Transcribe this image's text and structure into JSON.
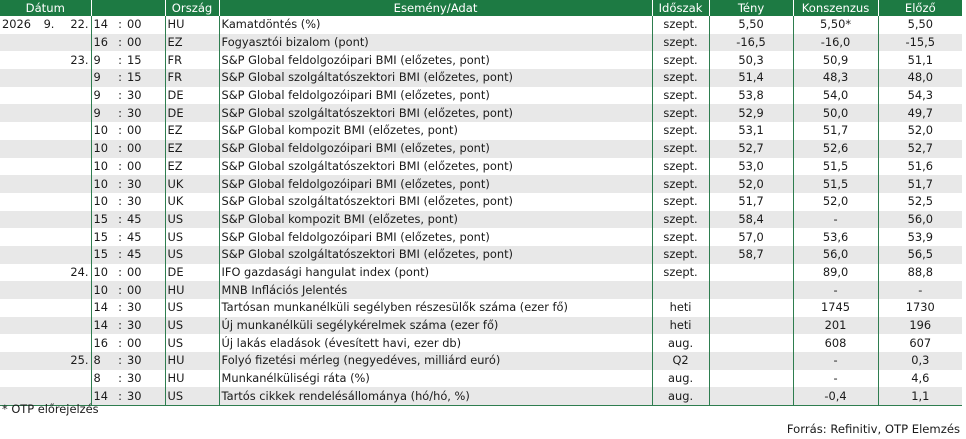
{
  "headers": {
    "date": "Dátum",
    "country": "Ország",
    "event": "Esemény/Adat",
    "period": "Időszak",
    "actual": "Tény",
    "consensus": "Konszenzus",
    "previous": "Előző"
  },
  "rows": [
    {
      "year": "2026",
      "month": "9.",
      "day": "22.",
      "hour": "14",
      "min": "00",
      "country": "HU",
      "event": "Kamatdöntés (%)",
      "period": "szept.",
      "actual": "5,50",
      "consensus": "5,50*",
      "previous": "5,50"
    },
    {
      "year": "",
      "month": "",
      "day": "",
      "hour": "16",
      "min": "00",
      "country": "EZ",
      "event": "Fogyasztói bizalom (pont)",
      "period": "szept.",
      "actual": "-16,5",
      "consensus": "-16,0",
      "previous": "-15,5"
    },
    {
      "year": "",
      "month": "",
      "day": "23.",
      "hour": "9",
      "min": "15",
      "country": "FR",
      "event": "S&P Global feldolgozóipari BMI (előzetes, pont)",
      "period": "szept.",
      "actual": "50,3",
      "consensus": "50,9",
      "previous": "51,1"
    },
    {
      "year": "",
      "month": "",
      "day": "",
      "hour": "9",
      "min": "15",
      "country": "FR",
      "event": "S&P Global szolgáltatószektori BMI (előzetes, pont)",
      "period": "szept.",
      "actual": "51,4",
      "consensus": "48,3",
      "previous": "48,0"
    },
    {
      "year": "",
      "month": "",
      "day": "",
      "hour": "9",
      "min": "30",
      "country": "DE",
      "event": "S&P Global feldolgozóipari BMI (előzetes, pont)",
      "period": "szept.",
      "actual": "53,8",
      "consensus": "54,0",
      "previous": "54,3"
    },
    {
      "year": "",
      "month": "",
      "day": "",
      "hour": "9",
      "min": "30",
      "country": "DE",
      "event": "S&P Global szolgáltatószektori BMI (előzetes, pont)",
      "period": "szept.",
      "actual": "52,9",
      "consensus": "50,0",
      "previous": "49,7"
    },
    {
      "year": "",
      "month": "",
      "day": "",
      "hour": "10",
      "min": "00",
      "country": "EZ",
      "event": "S&P Global kompozit BMI (előzetes, pont)",
      "period": "szept.",
      "actual": "53,1",
      "consensus": "51,7",
      "previous": "52,0"
    },
    {
      "year": "",
      "month": "",
      "day": "",
      "hour": "10",
      "min": "00",
      "country": "EZ",
      "event": "S&P Global feldolgozóipari BMI (előzetes, pont)",
      "period": "szept.",
      "actual": "52,7",
      "consensus": "52,6",
      "previous": "52,7"
    },
    {
      "year": "",
      "month": "",
      "day": "",
      "hour": "10",
      "min": "00",
      "country": "EZ",
      "event": "S&P Global szolgáltatószektori BMI (előzetes, pont)",
      "period": "szept.",
      "actual": "53,0",
      "consensus": "51,5",
      "previous": "51,6"
    },
    {
      "year": "",
      "month": "",
      "day": "",
      "hour": "10",
      "min": "30",
      "country": "UK",
      "event": "S&P Global feldolgozóipari BMI (előzetes, pont)",
      "period": "szept.",
      "actual": "52,0",
      "consensus": "51,5",
      "previous": "51,7"
    },
    {
      "year": "",
      "month": "",
      "day": "",
      "hour": "10",
      "min": "30",
      "country": "UK",
      "event": "S&P Global szolgáltatószektori BMI (előzetes, pont)",
      "period": "szept.",
      "actual": "51,7",
      "consensus": "52,0",
      "previous": "52,5"
    },
    {
      "year": "",
      "month": "",
      "day": "",
      "hour": "15",
      "min": "45",
      "country": "US",
      "event": "S&P Global kompozit BMI (előzetes, pont)",
      "period": "szept.",
      "actual": "58,4",
      "consensus": "-",
      "previous": "56,0"
    },
    {
      "year": "",
      "month": "",
      "day": "",
      "hour": "15",
      "min": "45",
      "country": "US",
      "event": "S&P Global feldolgozóipari BMI (előzetes, pont)",
      "period": "szept.",
      "actual": "57,0",
      "consensus": "53,6",
      "previous": "53,9"
    },
    {
      "year": "",
      "month": "",
      "day": "",
      "hour": "15",
      "min": "45",
      "country": "US",
      "event": "S&P Global szolgáltatószektori BMI (előzetes, pont)",
      "period": "szept.",
      "actual": "58,7",
      "consensus": "56,0",
      "previous": "56,5"
    },
    {
      "year": "",
      "month": "",
      "day": "24.",
      "hour": "10",
      "min": "00",
      "country": "DE",
      "event": "IFO gazdasági hangulat index (pont)",
      "period": "szept.",
      "actual": "",
      "consensus": "89,0",
      "previous": "88,8"
    },
    {
      "year": "",
      "month": "",
      "day": "",
      "hour": "10",
      "min": "00",
      "country": "HU",
      "event": "MNB Inflációs Jelentés",
      "period": "",
      "actual": "",
      "consensus": "-",
      "previous": "-"
    },
    {
      "year": "",
      "month": "",
      "day": "",
      "hour": "14",
      "min": "30",
      "country": "US",
      "event": "Tartósan munkanélküli segélyben részesülők száma (ezer fő)",
      "period": "heti",
      "actual": "",
      "consensus": "1745",
      "previous": "1730"
    },
    {
      "year": "",
      "month": "",
      "day": "",
      "hour": "14",
      "min": "30",
      "country": "US",
      "event": "Új munkanélküli segélykérelmek száma (ezer fő)",
      "period": "heti",
      "actual": "",
      "consensus": "201",
      "previous": "196"
    },
    {
      "year": "",
      "month": "",
      "day": "",
      "hour": "16",
      "min": "00",
      "country": "US",
      "event": "Új lakás eladások (évesített havi, ezer db)",
      "period": "aug.",
      "actual": "",
      "consensus": "608",
      "previous": "607"
    },
    {
      "year": "",
      "month": "",
      "day": "25.",
      "hour": "8",
      "min": "30",
      "country": "HU",
      "event": "Folyó fizetési mérleg (negyedéves, milliárd euró)",
      "period": "Q2",
      "actual": "",
      "consensus": "-",
      "previous": "0,3"
    },
    {
      "year": "",
      "month": "",
      "day": "",
      "hour": "8",
      "min": "30",
      "country": "HU",
      "event": "Munkanélküliségi ráta (%)",
      "period": "aug.",
      "actual": "",
      "consensus": "-",
      "previous": "4,6"
    },
    {
      "year": "",
      "month": "",
      "day": "",
      "hour": "14",
      "min": "30",
      "country": "US",
      "event": "Tartós cikkek rendelésállománya (hó/hó, %)",
      "period": "aug.",
      "actual": "",
      "consensus": "-0,4",
      "previous": "1,1"
    }
  ],
  "time_separator": ":",
  "footnote": "* OTP előrejelzés",
  "source": "Forrás: Refinitiv, OTP Elemzés",
  "colors": {
    "header_bg": "#1d7a43",
    "header_text": "#ffffff",
    "row_alt": "#e8e8e8",
    "grid": "#2e7d4f"
  }
}
